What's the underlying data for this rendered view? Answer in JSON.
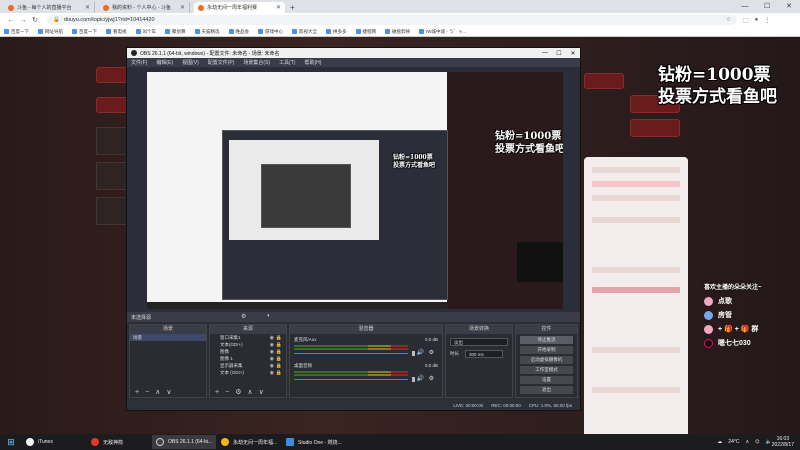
{
  "browser": {
    "tabs": [
      {
        "title": "斗鱼 - 每个人的直播平台",
        "active": false
      },
      {
        "title": "我的资料 - 个人中心 - 斗鱼",
        "active": false
      },
      {
        "title": "永劫无间一周年福利赛",
        "active": true
      }
    ],
    "new_tab": "+",
    "url": "douyu.com/topic/yjwj1?rid=10414420",
    "bookmarks": [
      "百度一下",
      "网址导航",
      "百度一下",
      "看电视",
      "叫个车",
      "聚划算",
      "天猫精选",
      "唯品会",
      "游戏中心",
      "影视大全",
      "拼多多",
      "捷程网",
      "磁盘剪映",
      "IW城中城 - う゛ぅ..."
    ]
  },
  "overlay": {
    "line1": "钻粉=1000票",
    "line2": "投票方式看鱼吧",
    "follow_header": "喜欢主播的朵朵关注~",
    "follow_items": [
      "点歌",
      "房管",
      "+ 🎁 + 🎁 群",
      "嗯七七030"
    ]
  },
  "obs": {
    "title": "OBS 26.1.1 (64-bit, windows) - 配置文件: 未命名 - 场景: 未命名",
    "menu": [
      "文件(F)",
      "编辑(E)",
      "视图(V)",
      "配置文件(P)",
      "场景集合(S)",
      "工具(T)",
      "帮助(H)"
    ],
    "scenes_label": "未选择源",
    "panels": {
      "scenes": "场景",
      "sources": "来源",
      "mixer": "混音器",
      "transitions": "场景转换",
      "controls": "控件"
    },
    "scene_items": [
      "场景"
    ],
    "source_items": [
      "窗口采集1",
      "文本(GDI+)",
      "图像",
      "图像 1",
      "显示器采集",
      "文本 (GDI+)"
    ],
    "mixer_tracks": [
      {
        "name": "麦克风/Aux",
        "db": "0.0 dB"
      },
      {
        "name": "桌面音频",
        "db": "0.0 dB"
      }
    ],
    "transition": {
      "type": "淡出",
      "duration_label": "时长",
      "duration": "300 ms"
    },
    "controls": [
      "停止推流",
      "开始录制",
      "启动虚拟摄像机",
      "工作室模式",
      "设置",
      "退出"
    ],
    "status": {
      "live": "LIVE: 00:00:00",
      "rec": "REC: 00:00:00",
      "cpu": "CPU: 1.0%, 60.00 fps"
    }
  },
  "taskbar": {
    "start": "⊞",
    "tasks": [
      {
        "label": "iTunes",
        "color": "#f4f4f4",
        "active": false
      },
      {
        "label": "无敌神箭",
        "color": "#e0392b",
        "active": false
      },
      {
        "label": "OBS 26.1.1 (64-bi...",
        "color": "#444",
        "active": true
      },
      {
        "label": "永劫无间一周年福...",
        "color": "#f2b51b",
        "active": false
      },
      {
        "label": "Studio One - 燃烧...",
        "color": "#3b8ede",
        "active": false
      }
    ],
    "weather": "24°C",
    "time": "16:03",
    "date": "2022/8/17"
  }
}
